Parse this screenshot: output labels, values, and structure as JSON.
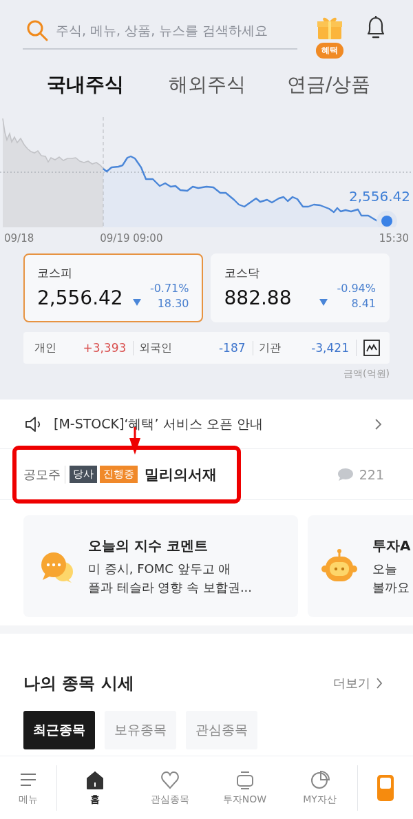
{
  "search": {
    "placeholder": "주식, 메뉴, 상품, 뉴스를 검색하세요"
  },
  "gift_badge": "혜택",
  "tabs": [
    {
      "label": "국내주식",
      "selected": true
    },
    {
      "label": "해외주식",
      "selected": false
    },
    {
      "label": "연금/상품",
      "selected": false
    }
  ],
  "chart": {
    "start_label": "09/18",
    "open_label": "09/19 09:00",
    "end_label": "15:30",
    "last_value": "2,556.42"
  },
  "indices": [
    {
      "name": "코스피",
      "value": "2,556.42",
      "change_pct": "-0.71%",
      "change": "18.30",
      "falling": true,
      "selected": true
    },
    {
      "name": "코스닥",
      "value": "882.88",
      "change_pct": "-0.94%",
      "change": "8.41",
      "falling": true,
      "selected": false
    }
  ],
  "investors": [
    {
      "label": "개인",
      "value": "+3,393",
      "falling": false
    },
    {
      "label": "외국인",
      "value": "-187",
      "falling": true
    },
    {
      "label": "기관",
      "value": "-3,421",
      "falling": true
    }
  ],
  "unit_note": "금액(억원)",
  "notice": "[M-STOCK]‘혜택’ 서비스 오픈 안내",
  "ipo": {
    "category": "공모주",
    "tags": [
      {
        "label": "당사",
        "color": "#47505b"
      },
      {
        "label": "진행중",
        "color": "#f0892a"
      }
    ],
    "name": "밀리의서재",
    "comments": "221"
  },
  "comment_cards": [
    {
      "kind": "chat",
      "title": "오늘의 지수 코멘트",
      "lines": [
        "미 증시, FOMC 앞두고 애",
        "플과 테슬라 영향 속 보합권..."
      ]
    },
    {
      "kind": "robot",
      "title": "투자A",
      "lines": [
        "오늘",
        "볼까요"
      ]
    }
  ],
  "annotation": {
    "arrow": true,
    "highlight_box": true
  },
  "my_stocks": {
    "title": "나의 종목 시세",
    "more": "더보기",
    "chips": [
      {
        "label": "최근종목",
        "selected": true
      },
      {
        "label": "보유종목",
        "selected": false
      },
      {
        "label": "관심종목",
        "selected": false
      }
    ]
  },
  "nav": [
    {
      "kind": "menu",
      "label": "메뉴",
      "selected": false
    },
    {
      "kind": "home",
      "label": "홈",
      "selected": true
    },
    {
      "kind": "heart",
      "label": "관심종목",
      "selected": false
    },
    {
      "kind": "tv",
      "label": "투자NOW",
      "selected": false
    },
    {
      "kind": "pie",
      "label": "MY자산",
      "selected": false
    },
    {
      "kind": "phone"
    }
  ]
}
